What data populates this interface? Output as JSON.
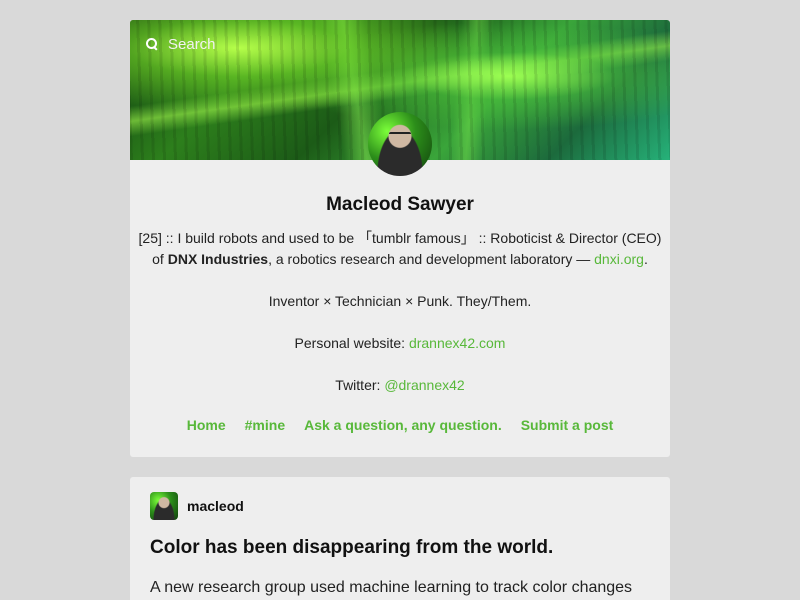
{
  "search": {
    "placeholder": "Search"
  },
  "profile": {
    "name": "Macleod Sawyer",
    "bio_1_part1": "[25] :: I build robots and used to be ",
    "bio_1_quote": "「tumblr famous」",
    "bio_1_part2": " :: Roboticist & Director (CEO)",
    "bio_2_of": "of ",
    "bio_2_company": "DNX Industries",
    "bio_2_rest": ", a robotics research and development laboratory — ",
    "bio_2_link": "dnxi.org",
    "bio_2_end": ".",
    "bio_3": "Inventor × Technician × Punk. They/Them.",
    "website_label": "Personal website: ",
    "website_link": "drannex42.com",
    "twitter_label": "Twitter: ",
    "twitter_link": "@drannex42"
  },
  "nav": {
    "items": [
      {
        "label": "Home"
      },
      {
        "label": "#mine"
      },
      {
        "label": "Ask a question, any question."
      },
      {
        "label": "Submit a post"
      }
    ]
  },
  "post": {
    "author": "macleod",
    "title": "Color has been disappearing from the world.",
    "body": "A new research group used machine learning to track color changes"
  },
  "colors": {
    "link": "#58b83a",
    "page_bg": "#d9d9d9",
    "card_bg": "#eeeeee"
  }
}
